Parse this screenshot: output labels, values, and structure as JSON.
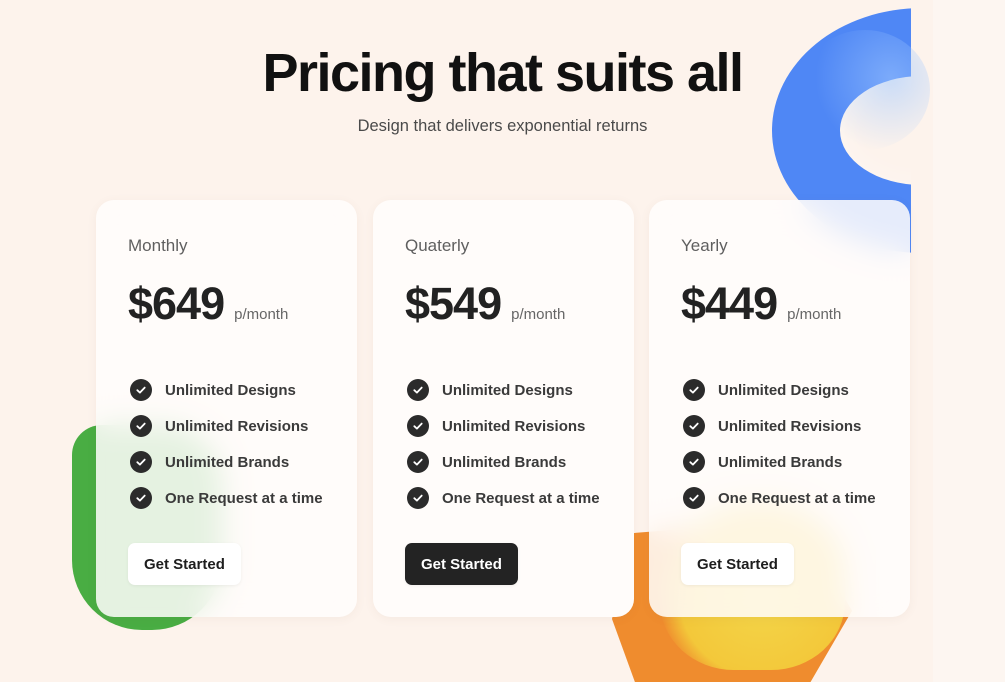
{
  "header": {
    "title": "Pricing that suits all",
    "subtitle": "Design that delivers exponential returns"
  },
  "plans": [
    {
      "name": "Monthly",
      "price": "$649",
      "period": "p/month",
      "features": [
        "Unlimited Designs",
        "Unlimited Revisions",
        "Unlimited Brands",
        "One Request at a time"
      ],
      "cta": "Get Started"
    },
    {
      "name": "Quaterly",
      "price": "$549",
      "period": "p/month",
      "features": [
        "Unlimited Designs",
        "Unlimited Revisions",
        "Unlimited Brands",
        "One Request at a time"
      ],
      "cta": "Get Started"
    },
    {
      "name": "Yearly",
      "price": "$449",
      "period": "p/month",
      "features": [
        "Unlimited Designs",
        "Unlimited Revisions",
        "Unlimited Brands",
        "One Request at a time"
      ],
      "cta": "Get Started"
    }
  ],
  "colors": {
    "background": "#fdf3ec",
    "card": "#fffcfa",
    "accent_dark": "#232323",
    "blob_blue": "#4f87f5",
    "blob_green": "#49ad43",
    "blob_orange": "#ef8c2e",
    "blob_yellow": "#f3d64a"
  },
  "icons": {
    "feature_check": "check-circle-icon"
  }
}
